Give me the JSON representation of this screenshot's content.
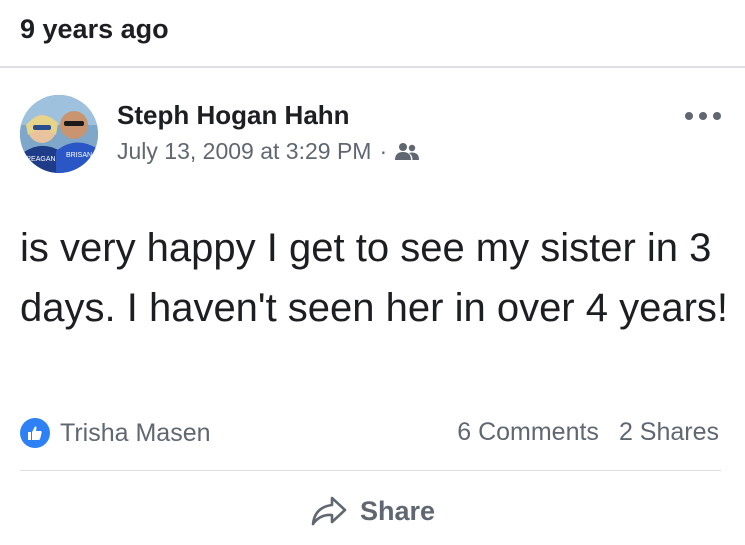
{
  "memory": {
    "label": "9 years ago"
  },
  "post": {
    "author": "Steph Hogan Hahn",
    "timestamp": "July 13, 2009 at 3:29 PM",
    "separator": "·",
    "audience_icon": "friends-icon",
    "text": "is very happy I get to see my sister in 3 days. I haven't seen her in over 4 years!",
    "reactions": {
      "icon": "like-icon",
      "names": "Trisha Masen"
    },
    "comments": "6 Comments",
    "shares": "2 Shares"
  },
  "actions": {
    "share_label": "Share"
  },
  "colors": {
    "like_blue": "#2e81f4",
    "secondary_text": "#606770",
    "divider": "#dddfe2"
  }
}
